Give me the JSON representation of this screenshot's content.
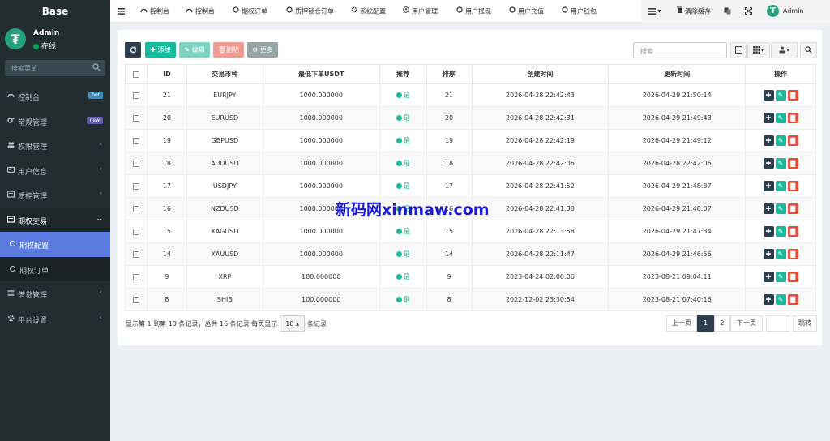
{
  "sidebar": {
    "brand": "Base",
    "user_name": "Admin",
    "user_status": "在线",
    "search_placeholder": "搜索菜单",
    "items": [
      {
        "label": "控制台",
        "badge": "hot",
        "badge_color": "#3c8dbc",
        "icon": "dashboard-icon"
      },
      {
        "label": "常规管理",
        "badge": "new",
        "badge_color": "#605ca8",
        "icon": "cogs-icon"
      },
      {
        "label": "权限管理",
        "icon": "group-icon"
      },
      {
        "label": "用户信息",
        "icon": "user-card-icon"
      },
      {
        "label": "质押管理",
        "icon": "list-icon"
      },
      {
        "label": "期权交易",
        "icon": "list-icon"
      },
      {
        "label": "期权配置",
        "sub": true
      },
      {
        "label": "期权订单",
        "sub": true
      },
      {
        "label": "借贷管理",
        "icon": "list-icon"
      },
      {
        "label": "平台设置",
        "icon": "gear-icon"
      }
    ]
  },
  "navbar": {
    "tabs": [
      {
        "label": "控制台"
      },
      {
        "label": "控制台"
      },
      {
        "label": "期权订单"
      },
      {
        "label": "质押锁仓订单"
      },
      {
        "label": "系统配置"
      },
      {
        "label": "用户管理"
      },
      {
        "label": "用户提现"
      },
      {
        "label": "用户充值"
      },
      {
        "label": "用户钱包"
      }
    ],
    "clear_cache": "清除缓存",
    "admin": "Admin"
  },
  "toolbar": {
    "add": "添加",
    "edit": "编辑",
    "delete": "删除",
    "more": "更多",
    "search_placeholder": "搜索"
  },
  "table": {
    "headers": [
      "ID",
      "交易币种",
      "最低下单USDT",
      "推荐",
      "排序",
      "创建时间",
      "更新时间",
      "操作"
    ],
    "rows": [
      {
        "id": "21",
        "pair": "EURJPY",
        "min": "1000.000000",
        "rec": "是",
        "sort": "21",
        "created": "2026-04-28 22:42:43",
        "updated": "2026-04-29 21:50:14"
      },
      {
        "id": "20",
        "pair": "EURUSD",
        "min": "1000.000000",
        "rec": "是",
        "sort": "20",
        "created": "2026-04-28 22:42:31",
        "updated": "2026-04-29 21:49:43"
      },
      {
        "id": "19",
        "pair": "GBPUSD",
        "min": "1000.000000",
        "rec": "是",
        "sort": "19",
        "created": "2026-04-28 22:42:19",
        "updated": "2026-04-29 21:49:12"
      },
      {
        "id": "18",
        "pair": "AUDUSD",
        "min": "1000.000000",
        "rec": "是",
        "sort": "18",
        "created": "2026-04-28 22:42:06",
        "updated": "2026-04-28 22:42:06"
      },
      {
        "id": "17",
        "pair": "USDJPY",
        "min": "1000.000000",
        "rec": "是",
        "sort": "17",
        "created": "2026-04-28 22:41:52",
        "updated": "2026-04-29 21:48:37"
      },
      {
        "id": "16",
        "pair": "NZDUSD",
        "min": "1000.000000",
        "rec": "是",
        "sort": "16",
        "created": "2026-04-28 22:41:38",
        "updated": "2026-04-29 21:48:07"
      },
      {
        "id": "15",
        "pair": "XAGUSD",
        "min": "1000.000000",
        "rec": "是",
        "sort": "15",
        "created": "2026-04-28 22:13:58",
        "updated": "2026-04-29 21:47:34"
      },
      {
        "id": "14",
        "pair": "XAUUSD",
        "min": "1000.000000",
        "rec": "是",
        "sort": "14",
        "created": "2026-04-28 22:11:47",
        "updated": "2026-04-29 21:46:56"
      },
      {
        "id": "9",
        "pair": "XRP",
        "min": "100.000000",
        "rec": "是",
        "sort": "9",
        "created": "2023-04-24 02:00:06",
        "updated": "2023-08-21 09:04:11"
      },
      {
        "id": "8",
        "pair": "SHIB",
        "min": "100.000000",
        "rec": "是",
        "sort": "8",
        "created": "2022-12-02 23:30:54",
        "updated": "2023-08-21 07:40:16"
      }
    ]
  },
  "footer": {
    "info_prefix": "显示第 1 到第 10 条记录，总共 16 条记录 每页显示",
    "page_size": "10",
    "info_suffix": "条记录",
    "prev": "上一页",
    "page1": "1",
    "page2": "2",
    "next": "下一页",
    "jump": "跳转"
  },
  "watermark": "新码网xinmaw.com",
  "colors": {
    "sidebar_bg": "#222d32",
    "accent": "#5b7be0",
    "success": "#18bc9c",
    "danger": "#e74c3c",
    "primary_dark": "#2c3e50"
  }
}
